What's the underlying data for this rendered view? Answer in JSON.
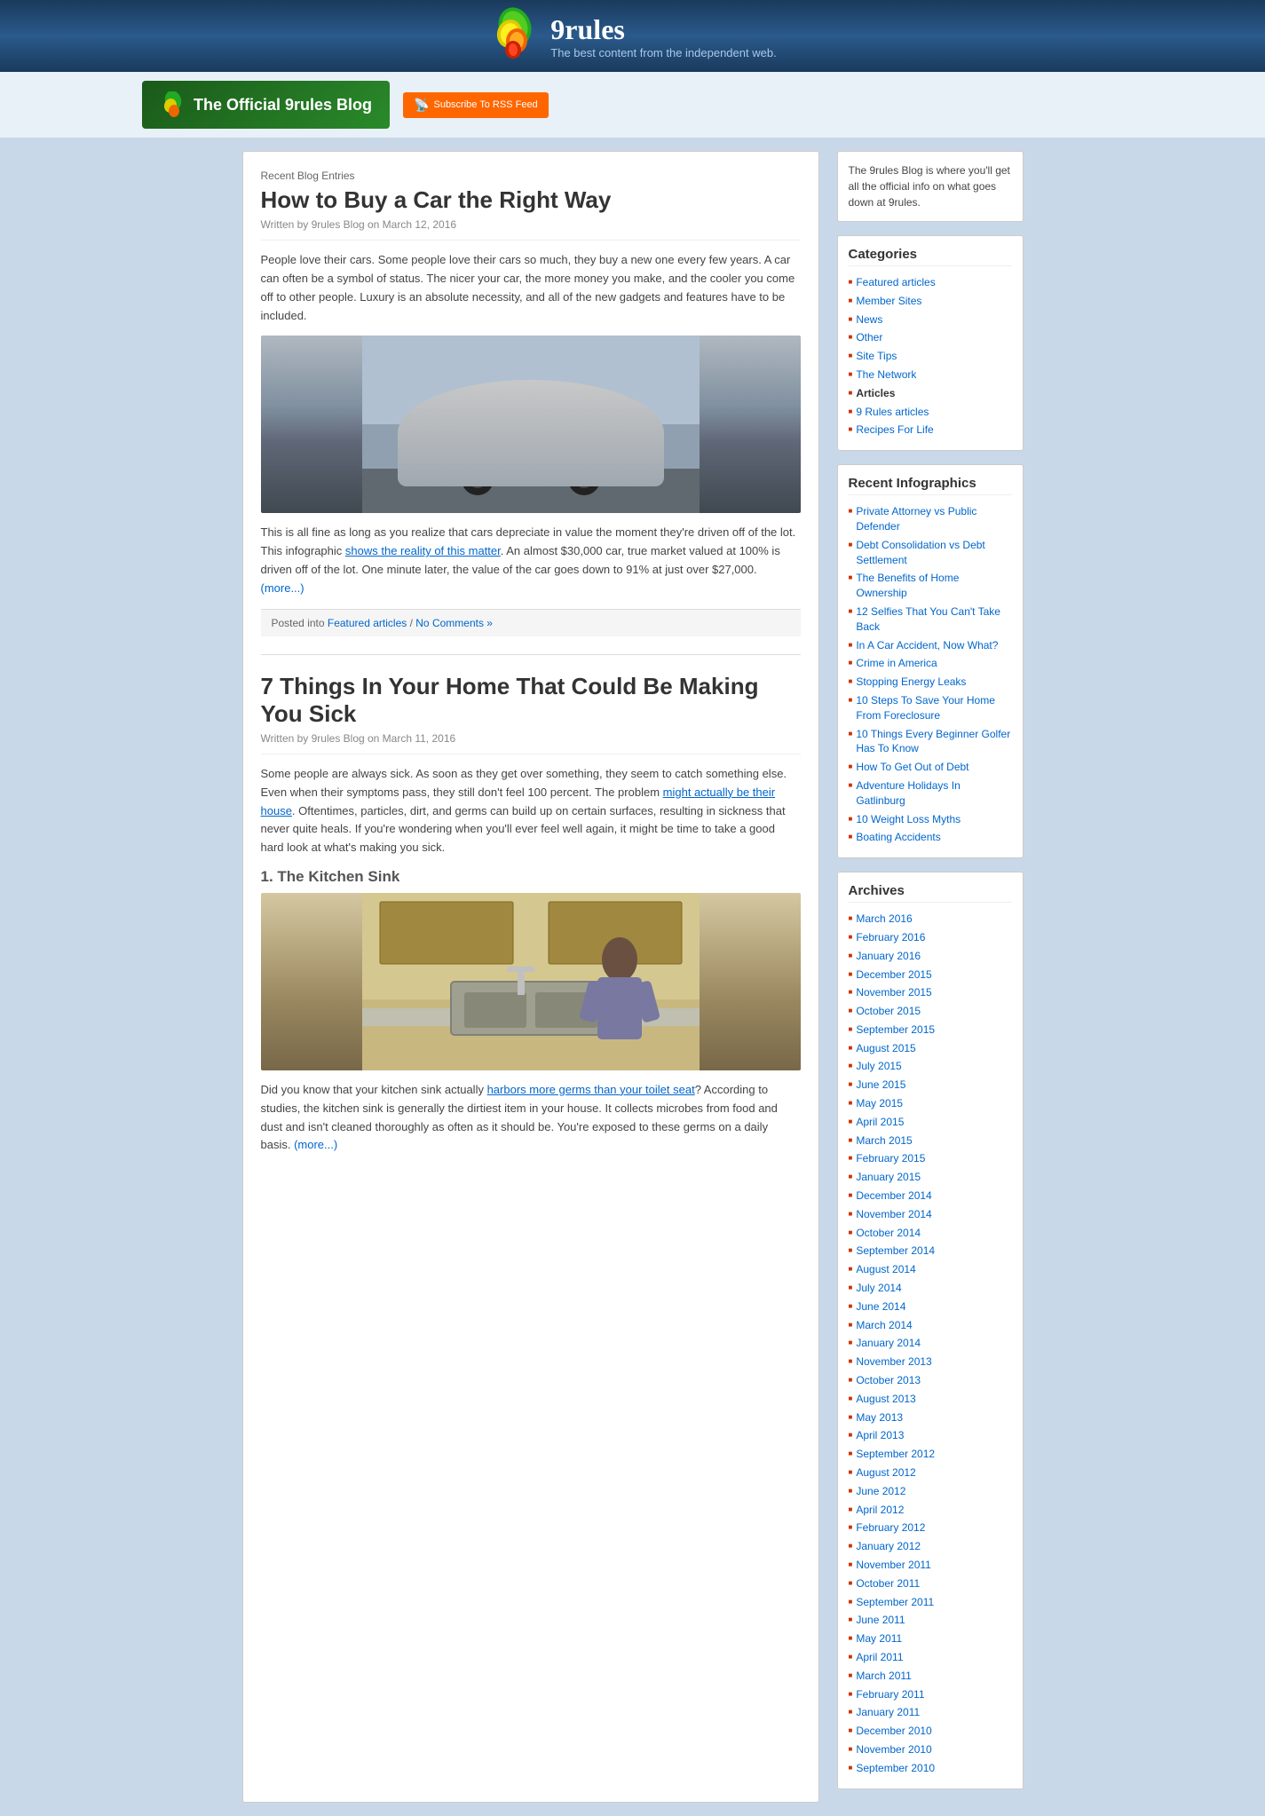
{
  "header": {
    "title": "9rules",
    "subtitle": "The best content from the independent web.",
    "banner_text": "The Official 9rules Blog",
    "rss_label": "Subscribe To RSS Feed"
  },
  "posts": [
    {
      "section_label": "Recent Blog Entries",
      "title": "How to Buy a Car the Right Way",
      "meta": "Written by 9rules Blog on March 12, 2016",
      "excerpt1": "People love their cars. Some people love their cars so much, they buy a new one every few years. A car can often be a symbol of status. The nicer your car, the more money you make, and the cooler you come off to other people. Luxury is an absolute necessity, and all of the new gadgets and features have to be included.",
      "excerpt2": "This is all fine as long as you realize that cars depreciate in value the moment they're driven off of the lot. This infographic ",
      "link_text": "shows the reality of this matter",
      "excerpt3": ". An almost $30,000 car, true market valued at 100% is driven off of the lot. One minute later, the value of the car goes down to 91% at just over $27,000.",
      "more_link": "(more...)",
      "footer": "Posted into Featured articles / No Comments »"
    },
    {
      "title": "7 Things In Your Home That Could Be Making You Sick",
      "meta": "Written by 9rules Blog on March 11, 2016",
      "excerpt1": "Some people are always sick. As soon as they get over something, they seem to catch something else. Even when their symptoms pass, they still don't feel 100 percent. The problem ",
      "link_text": "might actually be their house",
      "excerpt2": ". Oftentimes, particles, dirt, and germs can build up on certain surfaces, resulting in sickness that never quite heals. If you're wondering when you'll ever feel well again, it might be time to take a good hard look at what's making you sick.",
      "subheading": "1. The Kitchen Sink",
      "excerpt3": "Did you know that your kitchen sink actually ",
      "link_text2": "harbors more germs than your toilet seat",
      "excerpt4": "? According to studies, the kitchen sink is generally the dirtiest item in your house. It collects microbes from food and dust and isn't cleaned thoroughly as often as it should be. You're exposed to these germs on a daily basis.",
      "more_link": "(more...)"
    }
  ],
  "sidebar": {
    "intro": "The 9rules Blog is where you'll get all the official info on what goes down at 9rules.",
    "categories_heading": "Categories",
    "categories": [
      {
        "label": "Featured articles",
        "bold": false
      },
      {
        "label": "Member Sites",
        "bold": false
      },
      {
        "label": "News",
        "bold": false
      },
      {
        "label": "Other",
        "bold": false
      },
      {
        "label": "Site Tips",
        "bold": false
      },
      {
        "label": "The Network",
        "bold": false
      },
      {
        "label": "Articles",
        "bold": true
      },
      {
        "label": "9 Rules articles",
        "bold": false
      },
      {
        "label": "Recipes For Life",
        "bold": false
      }
    ],
    "infographics_heading": "Recent Infographics",
    "infographics": [
      "Private Attorney vs Public Defender",
      "Debt Consolidation vs Debt Settlement",
      "The Benefits of Home Ownership",
      "12 Selfies That You Can't Take Back",
      "In A Car Accident, Now What?",
      "Crime in America",
      "Stopping Energy Leaks",
      "10 Steps To Save Your Home From Foreclosure",
      "10 Things Every Beginner Golfer Has To Know",
      "How To Get Out of Debt",
      "Adventure Holidays In Gatlinburg",
      "10 Weight Loss Myths",
      "Boating Accidents"
    ],
    "archives_heading": "Archives",
    "archives": [
      "March 2016",
      "February 2016",
      "January 2016",
      "December 2015",
      "November 2015",
      "October 2015",
      "September 2015",
      "August 2015",
      "July 2015",
      "June 2015",
      "May 2015",
      "April 2015",
      "March 2015",
      "February 2015",
      "January 2015",
      "December 2014",
      "November 2014",
      "October 2014",
      "September 2014",
      "August 2014",
      "July 2014",
      "June 2014",
      "March 2014",
      "January 2014",
      "November 2013",
      "October 2013",
      "August 2013",
      "May 2013",
      "April 2013",
      "September 2012",
      "August 2012",
      "June 2012",
      "April 2012",
      "February 2012",
      "January 2012",
      "November 2011",
      "October 2011",
      "September 2011",
      "June 2011",
      "May 2011",
      "April 2011",
      "March 2011",
      "February 2011",
      "January 2011",
      "December 2010",
      "November 2010",
      "September 2010"
    ]
  }
}
